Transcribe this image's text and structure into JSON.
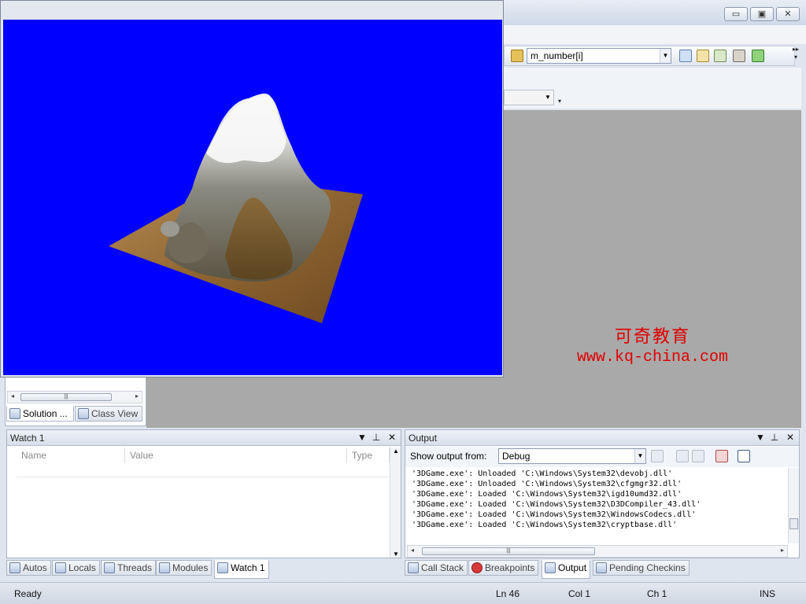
{
  "window_controls": {
    "minimize": "▭",
    "restore": "▣",
    "close": "✕"
  },
  "toolbar": {
    "find_combo_value": "m_number[i]",
    "icons": [
      "find-in-files-icon",
      "solution-explorer-icon",
      "properties-icon",
      "toolbox-icon",
      "start-page-icon"
    ]
  },
  "solution_panel": {
    "tabs": [
      {
        "label": "Solution ...",
        "icon": "solution-explorer-icon",
        "active": true
      },
      {
        "label": "Class View",
        "icon": "class-view-icon",
        "active": false
      }
    ]
  },
  "watch_panel": {
    "title": "Watch 1",
    "columns": [
      "Name",
      "Value",
      "Type"
    ]
  },
  "output_panel": {
    "title": "Output",
    "show_output_from_label": "Show output from:",
    "show_output_from_value": "Debug",
    "lines": [
      "'3DGame.exe': Unloaded 'C:\\Windows\\System32\\devobj.dll'",
      "'3DGame.exe': Unloaded 'C:\\Windows\\System32\\cfgmgr32.dll'",
      "'3DGame.exe': Loaded 'C:\\Windows\\System32\\igd10umd32.dll'",
      "'3DGame.exe': Loaded 'C:\\Windows\\System32\\D3DCompiler_43.dll'",
      "'3DGame.exe': Loaded 'C:\\Windows\\System32\\WindowsCodecs.dll'",
      "'3DGame.exe': Loaded 'C:\\Windows\\System32\\cryptbase.dll'"
    ]
  },
  "bottom_left_tabs": [
    {
      "label": "Autos",
      "active": false
    },
    {
      "label": "Locals",
      "active": false
    },
    {
      "label": "Threads",
      "active": false
    },
    {
      "label": "Modules",
      "active": false
    },
    {
      "label": "Watch 1",
      "active": true
    }
  ],
  "bottom_right_tabs": [
    {
      "label": "Call Stack",
      "active": false
    },
    {
      "label": "Breakpoints",
      "active": false
    },
    {
      "label": "Output",
      "active": true
    },
    {
      "label": "Pending Checkins",
      "active": false
    }
  ],
  "status_bar": {
    "state": "Ready",
    "line": "Ln 46",
    "col": "Col 1",
    "ch": "Ch 1",
    "mode": "INS"
  },
  "watermark": {
    "chinese": "可奇教育",
    "url": "www.kq-china.com"
  },
  "colors": {
    "game_background": "#0000ff",
    "watermark": "#e00000",
    "editor_background": "#a9a9a9"
  }
}
